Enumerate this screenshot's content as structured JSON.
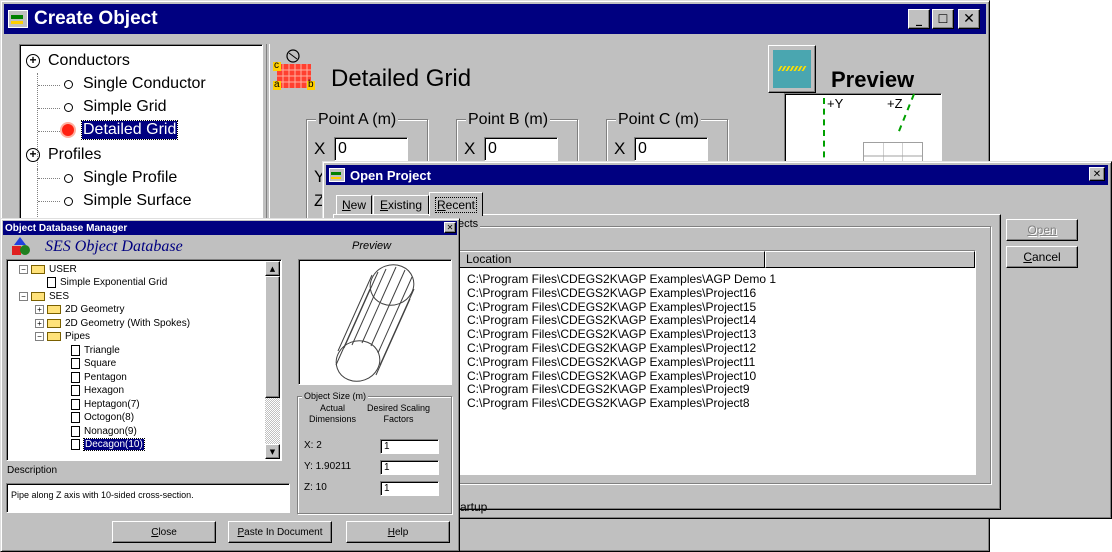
{
  "create_object": {
    "title": "Create Object",
    "tree": [
      {
        "label": "Conductors",
        "type": "group"
      },
      {
        "label": "Single Conductor",
        "type": "leaf"
      },
      {
        "label": "Simple Grid",
        "type": "leaf"
      },
      {
        "label": "Detailed Grid",
        "type": "leaf",
        "selected": true
      },
      {
        "label": "Profiles",
        "type": "group"
      },
      {
        "label": "Single Profile",
        "type": "leaf"
      },
      {
        "label": "Simple Surface",
        "type": "leaf"
      }
    ],
    "heading": "Detailed Grid",
    "preview_label": "Preview",
    "grid_icon_labels": {
      "a": "a",
      "b": "b",
      "c": "c"
    },
    "points": [
      {
        "label": "Point A (m)",
        "x_label": "X",
        "x_value": "0"
      },
      {
        "label": "Point B (m)",
        "x_label": "X",
        "x_value": "0"
      },
      {
        "label": "Point C (m)",
        "x_label": "X",
        "x_value": "0"
      }
    ],
    "axis_labels": {
      "y": "+Y",
      "z": "+Z"
    },
    "partial_labels": {
      "y": "Y",
      "z": "Z"
    }
  },
  "open_project": {
    "title": "Open Project",
    "tabs": [
      {
        "label": "New",
        "accel": "N"
      },
      {
        "label": "Existing",
        "accel": "E"
      },
      {
        "label": "Recent",
        "accel": "R",
        "active": true
      }
    ],
    "group_label": "ects",
    "column_header": "Location",
    "rows": [
      "C:\\Program Files\\CDEGS2K\\AGP Examples\\AGP Demo 1",
      "C:\\Program Files\\CDEGS2K\\AGP Examples\\Project16",
      "C:\\Program Files\\CDEGS2K\\AGP Examples\\Project15",
      "C:\\Program Files\\CDEGS2K\\AGP Examples\\Project14",
      "C:\\Program Files\\CDEGS2K\\AGP Examples\\Project13",
      "C:\\Program Files\\CDEGS2K\\AGP Examples\\Project12",
      "C:\\Program Files\\CDEGS2K\\AGP Examples\\Project11",
      "C:\\Program Files\\CDEGS2K\\AGP Examples\\Project10",
      "C:\\Program Files\\CDEGS2K\\AGP Examples\\Project9",
      "C:\\Program Files\\CDEGS2K\\AGP Examples\\Project8"
    ],
    "open_button": "Open",
    "cancel_button": "Cancel",
    "footer_partial": "artup"
  },
  "object_db": {
    "title": "Object Database Manager",
    "heading": "SES Object Database",
    "preview_label": "Preview",
    "tree": [
      {
        "label": "USER",
        "kind": "folder",
        "level": 0,
        "expander": "−"
      },
      {
        "label": "Simple Exponential Grid",
        "kind": "doc",
        "level": 1
      },
      {
        "label": "SES",
        "kind": "folder",
        "level": 0,
        "expander": "−"
      },
      {
        "label": "2D Geometry",
        "kind": "folder",
        "level": 1,
        "expander": "+"
      },
      {
        "label": "2D Geometry (With Spokes)",
        "kind": "folder",
        "level": 1,
        "expander": "+"
      },
      {
        "label": "Pipes",
        "kind": "folder",
        "level": 1,
        "expander": "−"
      },
      {
        "label": "Triangle",
        "kind": "doc",
        "level": 2
      },
      {
        "label": "Square",
        "kind": "doc",
        "level": 2
      },
      {
        "label": "Pentagon",
        "kind": "doc",
        "level": 2
      },
      {
        "label": "Hexagon",
        "kind": "doc",
        "level": 2
      },
      {
        "label": "Heptagon(7)",
        "kind": "doc",
        "level": 2
      },
      {
        "label": "Octogon(8)",
        "kind": "doc",
        "level": 2
      },
      {
        "label": "Nonagon(9)",
        "kind": "doc",
        "level": 2
      },
      {
        "label": "Decagon(10)",
        "kind": "doc",
        "level": 2,
        "selected": true
      }
    ],
    "size_group_label": "Object Size (m)",
    "actual_label": "Actual\nDimensions",
    "scaling_label": "Desired Scaling\nFactors",
    "dims": [
      {
        "label": "X: 2",
        "factor": "1"
      },
      {
        "label": "Y: 1.90211",
        "factor": "1"
      },
      {
        "label": "Z: 10",
        "factor": "1"
      }
    ],
    "description_label": "Description",
    "description_text": "Pipe along Z axis with 10-sided cross-section.",
    "buttons": [
      {
        "label": "Close",
        "accel": "C"
      },
      {
        "label": "Paste In Document",
        "accel": "P"
      },
      {
        "label": "Help",
        "accel": "H"
      }
    ]
  },
  "colors": {
    "titlebar": "#000080",
    "face": "#c0c0c0",
    "grid_icon": "#ff3020",
    "selection": "#000080"
  }
}
